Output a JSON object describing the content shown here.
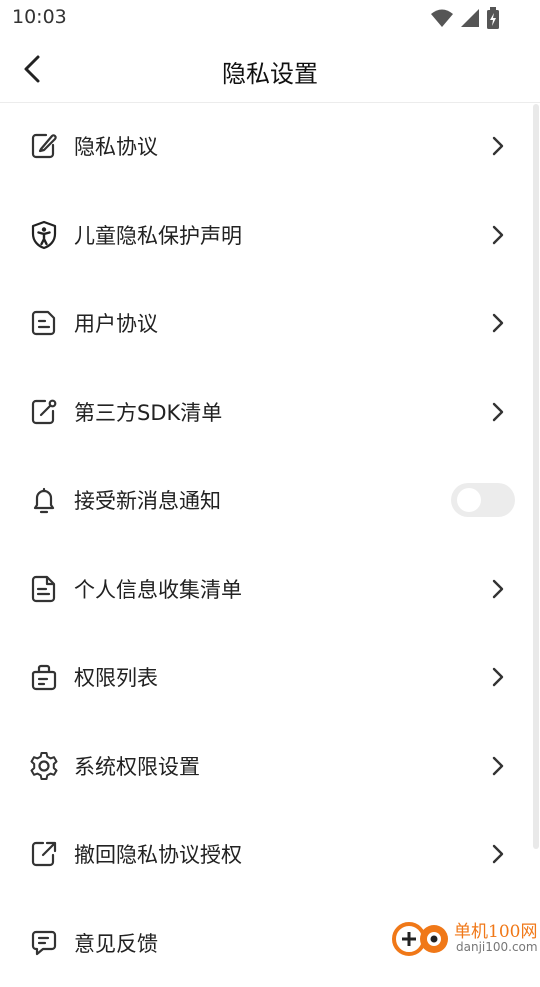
{
  "status_bar": {
    "time": "10:03",
    "icons": [
      "wifi-icon",
      "cell-signal-icon",
      "battery-charging-icon"
    ]
  },
  "header": {
    "title": "隐私设置",
    "back_icon": "chevron-left-icon"
  },
  "items": [
    {
      "label": "隐私协议",
      "icon": "edit-note-icon",
      "control": "chevron"
    },
    {
      "label": "儿童隐私保护声明",
      "icon": "child-shield-icon",
      "control": "chevron"
    },
    {
      "label": "用户协议",
      "icon": "document-icon",
      "control": "chevron"
    },
    {
      "label": "第三方SDK清单",
      "icon": "share-edit-icon",
      "control": "chevron"
    },
    {
      "label": "接受新消息通知",
      "icon": "bell-icon",
      "control": "toggle",
      "toggle_on": false
    },
    {
      "label": "个人信息收集清单",
      "icon": "file-list-icon",
      "control": "chevron"
    },
    {
      "label": "权限列表",
      "icon": "bag-list-icon",
      "control": "chevron"
    },
    {
      "label": "系统权限设置",
      "icon": "gear-icon",
      "control": "chevron"
    },
    {
      "label": "撤回隐私协议授权",
      "icon": "external-link-icon",
      "control": "chevron"
    },
    {
      "label": "意见反馈",
      "icon": "message-icon",
      "control": "chevron"
    }
  ],
  "watermark": {
    "text_cn": "单机100网",
    "text_en": "danji100.com",
    "icon": "danji-logo-icon"
  },
  "colors": {
    "watermark_accent": "#f07818",
    "toggle_off": "#ececec"
  }
}
